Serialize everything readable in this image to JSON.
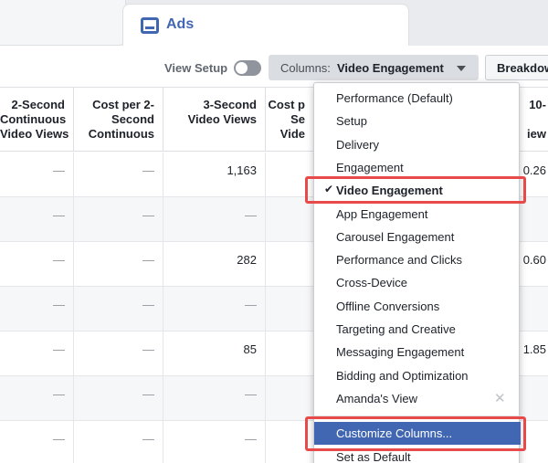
{
  "tabs": {
    "ads_label": "Ads"
  },
  "toolbar": {
    "view_setup_label": "View Setup",
    "columns_label": "Columns:",
    "columns_value": "Video Engagement",
    "breakdown_label": "Breakdown"
  },
  "table": {
    "headers": [
      "2-Second\nContinuous\nVideo Views",
      "Cost per 2-\nSecond\nContinuous",
      "3-Second\nVideo Views",
      "Cost p\nSe\nVide",
      "",
      "10-\n  \niew"
    ],
    "rows": [
      [
        "—",
        "—",
        "1,163",
        "",
        "",
        "0.26"
      ],
      [
        "—",
        "—",
        "—",
        "",
        "",
        ""
      ],
      [
        "—",
        "—",
        "282",
        "",
        "",
        "0.60"
      ],
      [
        "—",
        "—",
        "—",
        "",
        "",
        ""
      ],
      [
        "—",
        "—",
        "85",
        "",
        "",
        "1.85"
      ],
      [
        "—",
        "—",
        "—",
        "",
        "",
        ""
      ],
      [
        "—",
        "—",
        "—",
        "",
        "",
        ""
      ]
    ]
  },
  "menu": {
    "items": [
      "Performance (Default)",
      "Setup",
      "Delivery",
      "Engagement",
      "Video Engagement",
      "App Engagement",
      "Carousel Engagement",
      "Performance and Clicks",
      "Cross-Device",
      "Offline Conversions",
      "Targeting and Creative",
      "Messaging Engagement",
      "Bidding and Optimization",
      "Amanda's View"
    ],
    "selected_index": 4,
    "customize_label": "Customize Columns...",
    "default_label": "Set as Default",
    "check_glyph": "✔",
    "close_glyph": "✕"
  },
  "colors": {
    "accent": "#4267b2",
    "callout": "#e84a4a",
    "toolbar_button": "#dadde1"
  }
}
